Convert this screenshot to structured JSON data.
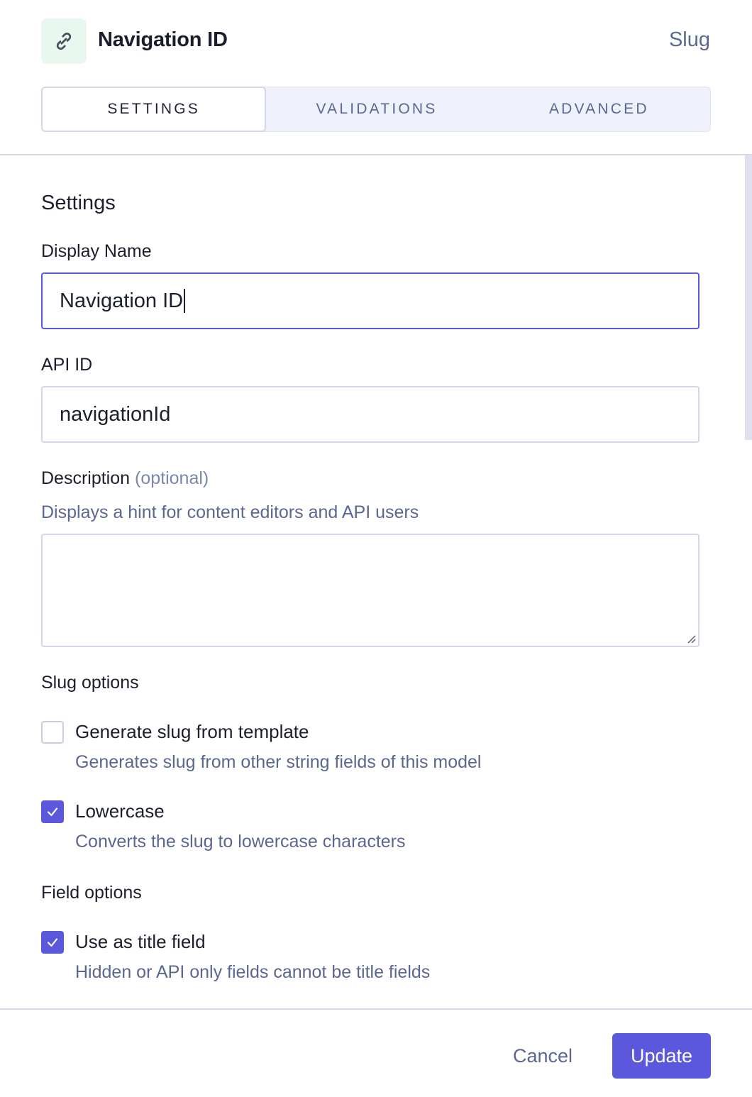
{
  "header": {
    "icon": "link-icon",
    "title": "Navigation ID",
    "field_type": "Slug",
    "colors": {
      "icon_bg": "#e8f8ef",
      "accent": "#5b58dc"
    }
  },
  "tabs": [
    {
      "label": "Settings",
      "active": true
    },
    {
      "label": "Validations",
      "active": false
    },
    {
      "label": "Advanced",
      "active": false
    }
  ],
  "settings": {
    "section_title": "Settings",
    "display_name": {
      "label": "Display Name",
      "value": "Navigation ID",
      "focused": true
    },
    "api_id": {
      "label": "API ID",
      "value": "navigationId"
    },
    "description": {
      "label": "Description",
      "optional_tag": "(optional)",
      "hint": "Displays a hint for content editors and API users",
      "value": ""
    },
    "slug_options": {
      "title": "Slug options",
      "items": [
        {
          "label": "Generate slug from template",
          "hint": "Generates slug from other string fields of this model",
          "checked": false
        },
        {
          "label": "Lowercase",
          "hint": "Converts the slug to lowercase characters",
          "checked": true
        }
      ]
    },
    "field_options": {
      "title": "Field options",
      "items": [
        {
          "label": "Use as title field",
          "hint": "Hidden or API only fields cannot be title fields",
          "checked": true
        }
      ]
    }
  },
  "footer": {
    "cancel_label": "Cancel",
    "update_label": "Update"
  }
}
